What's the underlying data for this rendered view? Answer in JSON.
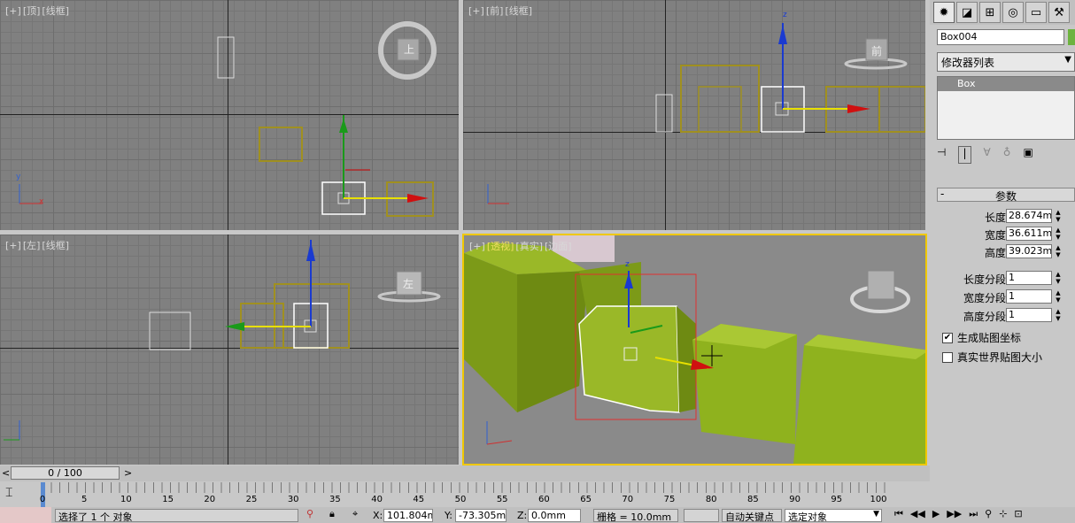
{
  "viewports": {
    "top": {
      "labels": [
        "[+]",
        "[顶]",
        "[线框]"
      ]
    },
    "front": {
      "labels": [
        "[+]",
        "[前]",
        "[线框]"
      ]
    },
    "left": {
      "labels": [
        "[+]",
        "[左]",
        "[线框]"
      ]
    },
    "perspective": {
      "labels": [
        "[+]",
        "[透视]",
        "[真实]",
        "[边面]"
      ]
    },
    "axis_z": "z",
    "axis_x": "x",
    "axis_y": "y",
    "viewcube_top": "上",
    "viewcube_front": "前",
    "viewcube_left": "左"
  },
  "command_panel": {
    "tabs": [
      "create-icon",
      "modify-icon",
      "hierarchy-icon",
      "motion-icon",
      "display-icon",
      "utilities-icon"
    ],
    "object_name": "Box004",
    "object_color": "#6db33f",
    "modifier_list": "修改器列表",
    "stack_items": [
      "Box"
    ],
    "rollout_title": "参数",
    "params": [
      {
        "label": "长度:",
        "value": "28.674mm"
      },
      {
        "label": "宽度:",
        "value": "36.611mm"
      },
      {
        "label": "高度:",
        "value": "39.023mm"
      },
      {
        "label": "长度分段:",
        "value": "1"
      },
      {
        "label": "宽度分段:",
        "value": "1"
      },
      {
        "label": "高度分段:",
        "value": "1"
      }
    ],
    "checkboxes": [
      {
        "label": "生成贴图坐标",
        "checked": "✔"
      },
      {
        "label": "真实世界贴图大小",
        "checked": ""
      }
    ]
  },
  "timeline": {
    "slider": "0 / 100",
    "prev": "<",
    "next": ">",
    "ticks": [
      "0",
      "5",
      "10",
      "15",
      "20",
      "25",
      "30",
      "35",
      "40",
      "45",
      "50",
      "55",
      "60",
      "65",
      "70",
      "75",
      "80",
      "85",
      "90",
      "95",
      "100"
    ]
  },
  "status": {
    "message": "选择了 1 个 对象",
    "x_label": "X:",
    "x_value": "101.804mm",
    "y_label": "Y:",
    "y_value": "-73.305mm",
    "z_label": "Z:",
    "z_value": "0.0mm",
    "grid": "栅格 = 10.0mm",
    "autokey": "自动关键点",
    "selection": "选定对象"
  },
  "colors": {
    "accent": "#f0c800",
    "box": "#8fb21e"
  }
}
